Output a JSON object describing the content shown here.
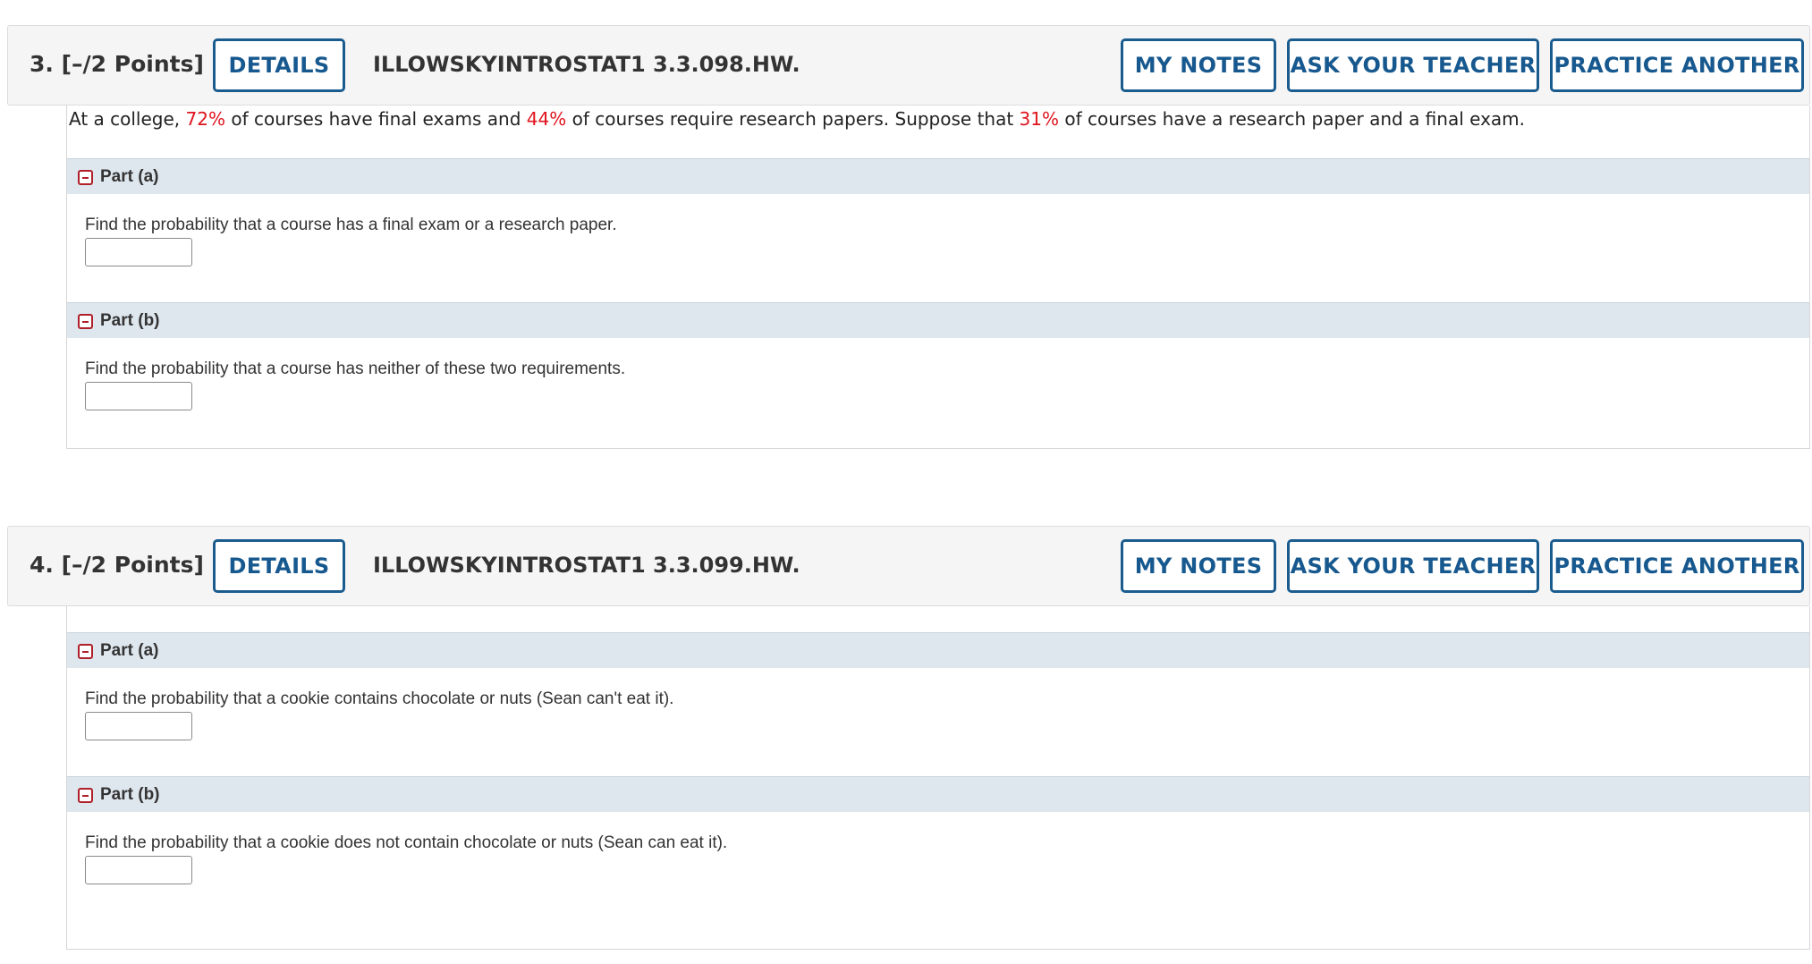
{
  "questions": [
    {
      "number_points": "3.  [–/2 Points]",
      "details_label": "DETAILS",
      "code": "ILLOWSKYINTROSTAT1 3.3.098.HW.",
      "my_notes_label": "MY NOTES",
      "ask_teacher_label": "ASK YOUR TEACHER",
      "practice_label": "PRACTICE ANOTHER",
      "intro": {
        "t1": "At a college, ",
        "v1": "72%",
        "t2": " of courses have final exams and ",
        "v2": "44%",
        "t3": " of courses require research papers. Suppose that ",
        "v3": "31%",
        "t4": " of courses have a research paper and a final exam."
      },
      "parts": [
        {
          "label": "Part (a)",
          "text": "Find the probability that a course has a final exam or a research paper.",
          "value": ""
        },
        {
          "label": "Part (b)",
          "text": "Find the probability that a course has neither of these two requirements.",
          "value": ""
        }
      ]
    },
    {
      "number_points": "4.  [–/2 Points]",
      "details_label": "DETAILS",
      "code": "ILLOWSKYINTROSTAT1 3.3.099.HW.",
      "my_notes_label": "MY NOTES",
      "ask_teacher_label": "ASK YOUR TEACHER",
      "practice_label": "PRACTICE ANOTHER",
      "parts": [
        {
          "label": "Part (a)",
          "text": "Find the probability that a cookie contains chocolate or nuts (Sean can't eat it).",
          "value": ""
        },
        {
          "label": "Part (b)",
          "text": "Find the probability that a cookie does not contain chocolate or nuts (Sean can eat it).",
          "value": ""
        }
      ]
    }
  ],
  "colors": {
    "accent": "#1b5c8f",
    "highlight_red": "#e0141e",
    "part_bar": "#dee6ee",
    "toggle_red": "#b0202a"
  },
  "icons": {
    "part_toggle": "collapse-minus-icon"
  }
}
